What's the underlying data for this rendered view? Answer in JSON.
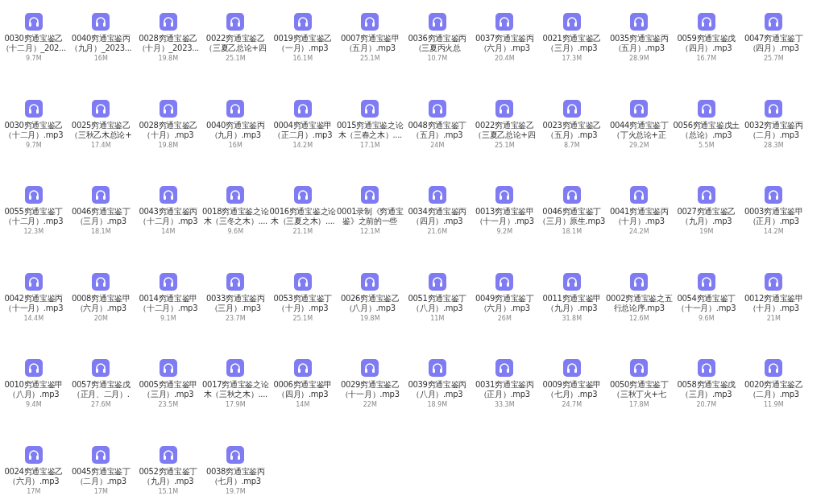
{
  "files": [
    {
      "lines": [
        "0030穷通宝鉴乙",
        "（十二月）_202..."
      ],
      "size": "9.7M"
    },
    {
      "lines": [
        "0040穷通宝鉴丙",
        "（九月）_2023..."
      ],
      "size": "16M"
    },
    {
      "lines": [
        "0028穷通宝鉴乙",
        "（十月）_2023..."
      ],
      "size": "19.8M"
    },
    {
      "lines": [
        "0022穷通宝鉴乙",
        "（三夏乙总论+四"
      ],
      "size": "25.1M"
    },
    {
      "lines": [
        "0019穷通宝鉴乙",
        "（一月）.mp3"
      ],
      "size": "16.1M"
    },
    {
      "lines": [
        "0007穷通宝鉴甲",
        "（五月）.mp3"
      ],
      "size": "25.1M"
    },
    {
      "lines": [
        "0036穷通宝鉴丙",
        "（三夏丙火总"
      ],
      "size": "10.7M"
    },
    {
      "lines": [
        "0037穷通宝鉴丙",
        "（六月）.mp3"
      ],
      "size": "20.4M"
    },
    {
      "lines": [
        "0021穷通宝鉴乙",
        "（三月）.mp3"
      ],
      "size": "17.3M"
    },
    {
      "lines": [
        "0035穷通宝鉴丙",
        "（五月）.mp3"
      ],
      "size": "28.9M"
    },
    {
      "lines": [
        "0059穷通宝鉴戊",
        "（四月）.mp3"
      ],
      "size": "16.7M"
    },
    {
      "lines": [
        "0047穷通宝鉴丁",
        "（四月）.mp3"
      ],
      "size": "25.7M"
    },
    {
      "lines": [
        "0030穷通宝鉴乙",
        "（十二月）.mp3"
      ],
      "size": "9.7M"
    },
    {
      "lines": [
        "0025穷通宝鉴乙",
        "（三秋乙木总论+"
      ],
      "size": "17.4M"
    },
    {
      "lines": [
        "0028穷通宝鉴乙",
        "（十月）.mp3"
      ],
      "size": "19.8M"
    },
    {
      "lines": [
        "0040穷通宝鉴丙",
        "（九月）.mp3"
      ],
      "size": "16M"
    },
    {
      "lines": [
        "0004穷通宝鉴甲",
        "（正二月）.mp3"
      ],
      "size": "14.2M"
    },
    {
      "lines": [
        "0015穷通宝鉴之论",
        "木（三春之木）...."
      ],
      "size": "17.1M"
    },
    {
      "lines": [
        "0048穷通宝鉴丁",
        "（五月）.mp3"
      ],
      "size": "24M"
    },
    {
      "lines": [
        "0022穷通宝鉴乙",
        "（三夏乙总论+四"
      ],
      "size": "25.1M"
    },
    {
      "lines": [
        "0023穷通宝鉴乙",
        "（五月）.mp3"
      ],
      "size": "8.7M"
    },
    {
      "lines": [
        "0044穷通宝鉴丁",
        "（丁火总论+正"
      ],
      "size": "29.2M"
    },
    {
      "lines": [
        "0056穷通宝鉴戊土",
        "（总论）.mp3"
      ],
      "size": "5.5M"
    },
    {
      "lines": [
        "0032穷通宝鉴丙",
        "（二月）.mp3"
      ],
      "size": "28.3M"
    },
    {
      "lines": [
        "0055穷通宝鉴丁",
        "（十二月）.mp3"
      ],
      "size": "12.3M"
    },
    {
      "lines": [
        "0046穷通宝鉴丁",
        "（三月）.mp3"
      ],
      "size": "18.1M"
    },
    {
      "lines": [
        "0043穷通宝鉴丙",
        "（十二月）.mp3"
      ],
      "size": "14M"
    },
    {
      "lines": [
        "0018穷通宝鉴之论",
        "木（三冬之木）...."
      ],
      "size": "9.6M"
    },
    {
      "lines": [
        "0016穷通宝鉴之论",
        "木（三夏之木）...."
      ],
      "size": "21.1M"
    },
    {
      "lines": [
        "0001录制《穷通宝",
        "鉴》之前的一些"
      ],
      "size": "12.1M"
    },
    {
      "lines": [
        "0034穷通宝鉴丙",
        "（四月）.mp3"
      ],
      "size": "21.6M"
    },
    {
      "lines": [
        "0013穷通宝鉴甲",
        "（十一月）.mp3"
      ],
      "size": "9.2M"
    },
    {
      "lines": [
        "0046穷通宝鉴丁",
        "（三月）原生.mp3"
      ],
      "size": "18.1M"
    },
    {
      "lines": [
        "0041穷通宝鉴丙",
        "（十月）.mp3"
      ],
      "size": "24.2M"
    },
    {
      "lines": [
        "0027穷通宝鉴乙",
        "（九月）.mp3"
      ],
      "size": "19M"
    },
    {
      "lines": [
        "0003穷通宝鉴甲",
        "（正月）.mp3"
      ],
      "size": "14.2M"
    },
    {
      "lines": [
        "0042穷通宝鉴丙",
        "（十一月）.mp3"
      ],
      "size": "14.4M"
    },
    {
      "lines": [
        "0008穷通宝鉴甲",
        "（六月）.mp3"
      ],
      "size": "20M"
    },
    {
      "lines": [
        "0014穷通宝鉴甲",
        "（十二月）.mp3"
      ],
      "size": "9.1M"
    },
    {
      "lines": [
        "0033穷通宝鉴丙",
        "（三月）.mp3"
      ],
      "size": "23.7M"
    },
    {
      "lines": [
        "0053穷通宝鉴丁",
        "（十月）.mp3"
      ],
      "size": "25.1M"
    },
    {
      "lines": [
        "0026穷通宝鉴乙",
        "（八月）.mp3"
      ],
      "size": "19.8M"
    },
    {
      "lines": [
        "0051穷通宝鉴丁",
        "（八月）.mp3"
      ],
      "size": "11M"
    },
    {
      "lines": [
        "0049穷通宝鉴丁",
        "（六月）.mp3"
      ],
      "size": "26M"
    },
    {
      "lines": [
        "0011穷通宝鉴甲",
        "（九月）.mp3"
      ],
      "size": "31.8M"
    },
    {
      "lines": [
        "0002穷通宝鉴之五",
        "行总论序.mp3"
      ],
      "size": "12.6M"
    },
    {
      "lines": [
        "0054穷通宝鉴丁",
        "（十一月）.mp3"
      ],
      "size": "9.6M"
    },
    {
      "lines": [
        "0012穷通宝鉴甲",
        "（十月）.mp3"
      ],
      "size": "21M"
    },
    {
      "lines": [
        "0010穷通宝鉴甲",
        "（八月）.mp3"
      ],
      "size": "9.4M"
    },
    {
      "lines": [
        "0057穷通宝鉴戊",
        "（正月、二月）."
      ],
      "size": "27.6M"
    },
    {
      "lines": [
        "0005穷通宝鉴甲",
        "（三月）.mp3"
      ],
      "size": "23.5M"
    },
    {
      "lines": [
        "0017穷通宝鉴之论",
        "木（三秋之木）...."
      ],
      "size": "17.9M"
    },
    {
      "lines": [
        "0006穷通宝鉴甲",
        "（四月）.mp3"
      ],
      "size": "14M"
    },
    {
      "lines": [
        "0029穷通宝鉴乙",
        "（十一月）.mp3"
      ],
      "size": "22M"
    },
    {
      "lines": [
        "0039穷通宝鉴丙",
        "（八月）.mp3"
      ],
      "size": "18.9M"
    },
    {
      "lines": [
        "0031穷通宝鉴丙",
        "（正月）.mp3"
      ],
      "size": "33.3M"
    },
    {
      "lines": [
        "0009穷通宝鉴甲",
        "（七月）.mp3"
      ],
      "size": "24.7M"
    },
    {
      "lines": [
        "0050穷通宝鉴丁",
        "（三秋丁火+七"
      ],
      "size": "17.8M"
    },
    {
      "lines": [
        "0058穷通宝鉴戊",
        "（三月）.mp3"
      ],
      "size": "20.7M"
    },
    {
      "lines": [
        "0020穷通宝鉴乙",
        "（二月）.mp3"
      ],
      "size": "11.9M"
    },
    {
      "lines": [
        "0024穷通宝鉴乙",
        "（六月）.mp3"
      ],
      "size": "17M"
    },
    {
      "lines": [
        "0045穷通宝鉴丁",
        "（二月）.mp3"
      ],
      "size": "17M"
    },
    {
      "lines": [
        "0052穷通宝鉴丁",
        "（九月）.mp3"
      ],
      "size": "15.1M"
    },
    {
      "lines": [
        "0038穷通宝鉴丙",
        "（七月）.mp3"
      ],
      "size": "19.7M"
    }
  ]
}
